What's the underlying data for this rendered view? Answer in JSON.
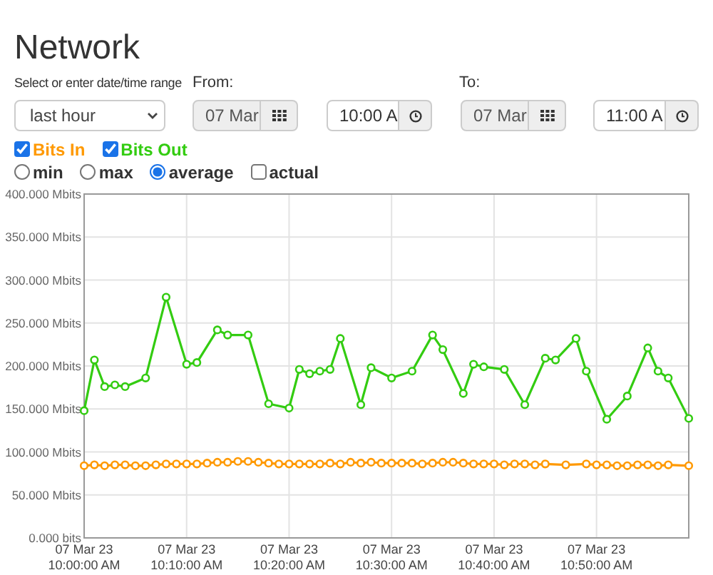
{
  "title": "Network",
  "range": {
    "label": "Select or enter date/time range",
    "value": "last hour"
  },
  "from": {
    "label": "From:",
    "date": "07 Mar",
    "time": "10:00 A"
  },
  "to": {
    "label": "To:",
    "date": "07 Mar",
    "time": "11:00 A"
  },
  "series_toggles": [
    {
      "checked": true
    },
    {
      "checked": true
    }
  ],
  "aggregations": [
    {
      "label": "min",
      "kind": "radio",
      "selected": false
    },
    {
      "label": "max",
      "kind": "radio",
      "selected": false
    },
    {
      "label": "average",
      "kind": "radio",
      "selected": true
    },
    {
      "label": "actual",
      "kind": "checkbox",
      "checked": false
    }
  ],
  "chart_data": {
    "type": "line",
    "grid": true,
    "ylim": [
      0,
      400
    ],
    "yticks": [
      {
        "value": 0,
        "label": "0.000 bits"
      },
      {
        "value": 50,
        "label": "50.000 Mbits"
      },
      {
        "value": 100,
        "label": "100.000 Mbits"
      },
      {
        "value": 150,
        "label": "150.000 Mbits"
      },
      {
        "value": 200,
        "label": "200.000 Mbits"
      },
      {
        "value": 250,
        "label": "250.000 Mbits"
      },
      {
        "value": 300,
        "label": "300.000 Mbits"
      },
      {
        "value": 350,
        "label": "350.000 Mbits"
      },
      {
        "value": 400,
        "label": "400.000 Mbits"
      }
    ],
    "categories": [
      "07 Mar 23 10:00:00 AM",
      null,
      null,
      null,
      null,
      null,
      null,
      null,
      null,
      null,
      "07 Mar 23 10:10:00 AM",
      null,
      null,
      null,
      null,
      null,
      null,
      null,
      null,
      null,
      "07 Mar 23 10:20:00 AM",
      null,
      null,
      null,
      null,
      null,
      null,
      null,
      null,
      null,
      "07 Mar 23 10:30:00 AM",
      null,
      null,
      null,
      null,
      null,
      null,
      null,
      null,
      null,
      "07 Mar 23 10:40:00 AM",
      null,
      null,
      null,
      null,
      null,
      null,
      null,
      null,
      null,
      "07 Mar 23 10:50:00 AM",
      null,
      null,
      null,
      null,
      null,
      null,
      null,
      null,
      null
    ],
    "series": [
      {
        "name": "Bits In",
        "marker": "circle",
        "color": "#ff9900",
        "values": [
          84,
          85,
          84,
          85,
          85,
          84,
          84,
          85,
          86,
          86,
          86,
          86,
          87,
          88,
          88,
          89,
          89,
          88,
          87,
          86,
          86,
          86,
          86,
          86,
          87,
          86,
          88,
          87,
          88,
          87,
          87,
          87,
          87,
          86,
          87,
          88,
          88,
          87,
          86,
          86,
          86,
          85,
          86,
          86,
          85,
          86,
          null,
          85,
          null,
          86,
          85,
          85,
          84,
          84,
          85,
          85,
          84,
          85,
          null,
          84
        ]
      },
      {
        "name": "Bits Out",
        "marker": "circle",
        "color": "#33cc11",
        "values": [
          148,
          207,
          176,
          178,
          176,
          null,
          186,
          null,
          280,
          null,
          202,
          204,
          null,
          242,
          236,
          null,
          236,
          null,
          156,
          null,
          151,
          196,
          191,
          194,
          196,
          232,
          null,
          155,
          198,
          null,
          186,
          null,
          194,
          null,
          236,
          219,
          null,
          168,
          202,
          199,
          null,
          196,
          null,
          155,
          null,
          209,
          207,
          null,
          232,
          194,
          null,
          138,
          null,
          165,
          null,
          221,
          194,
          186,
          null,
          139
        ]
      }
    ]
  }
}
